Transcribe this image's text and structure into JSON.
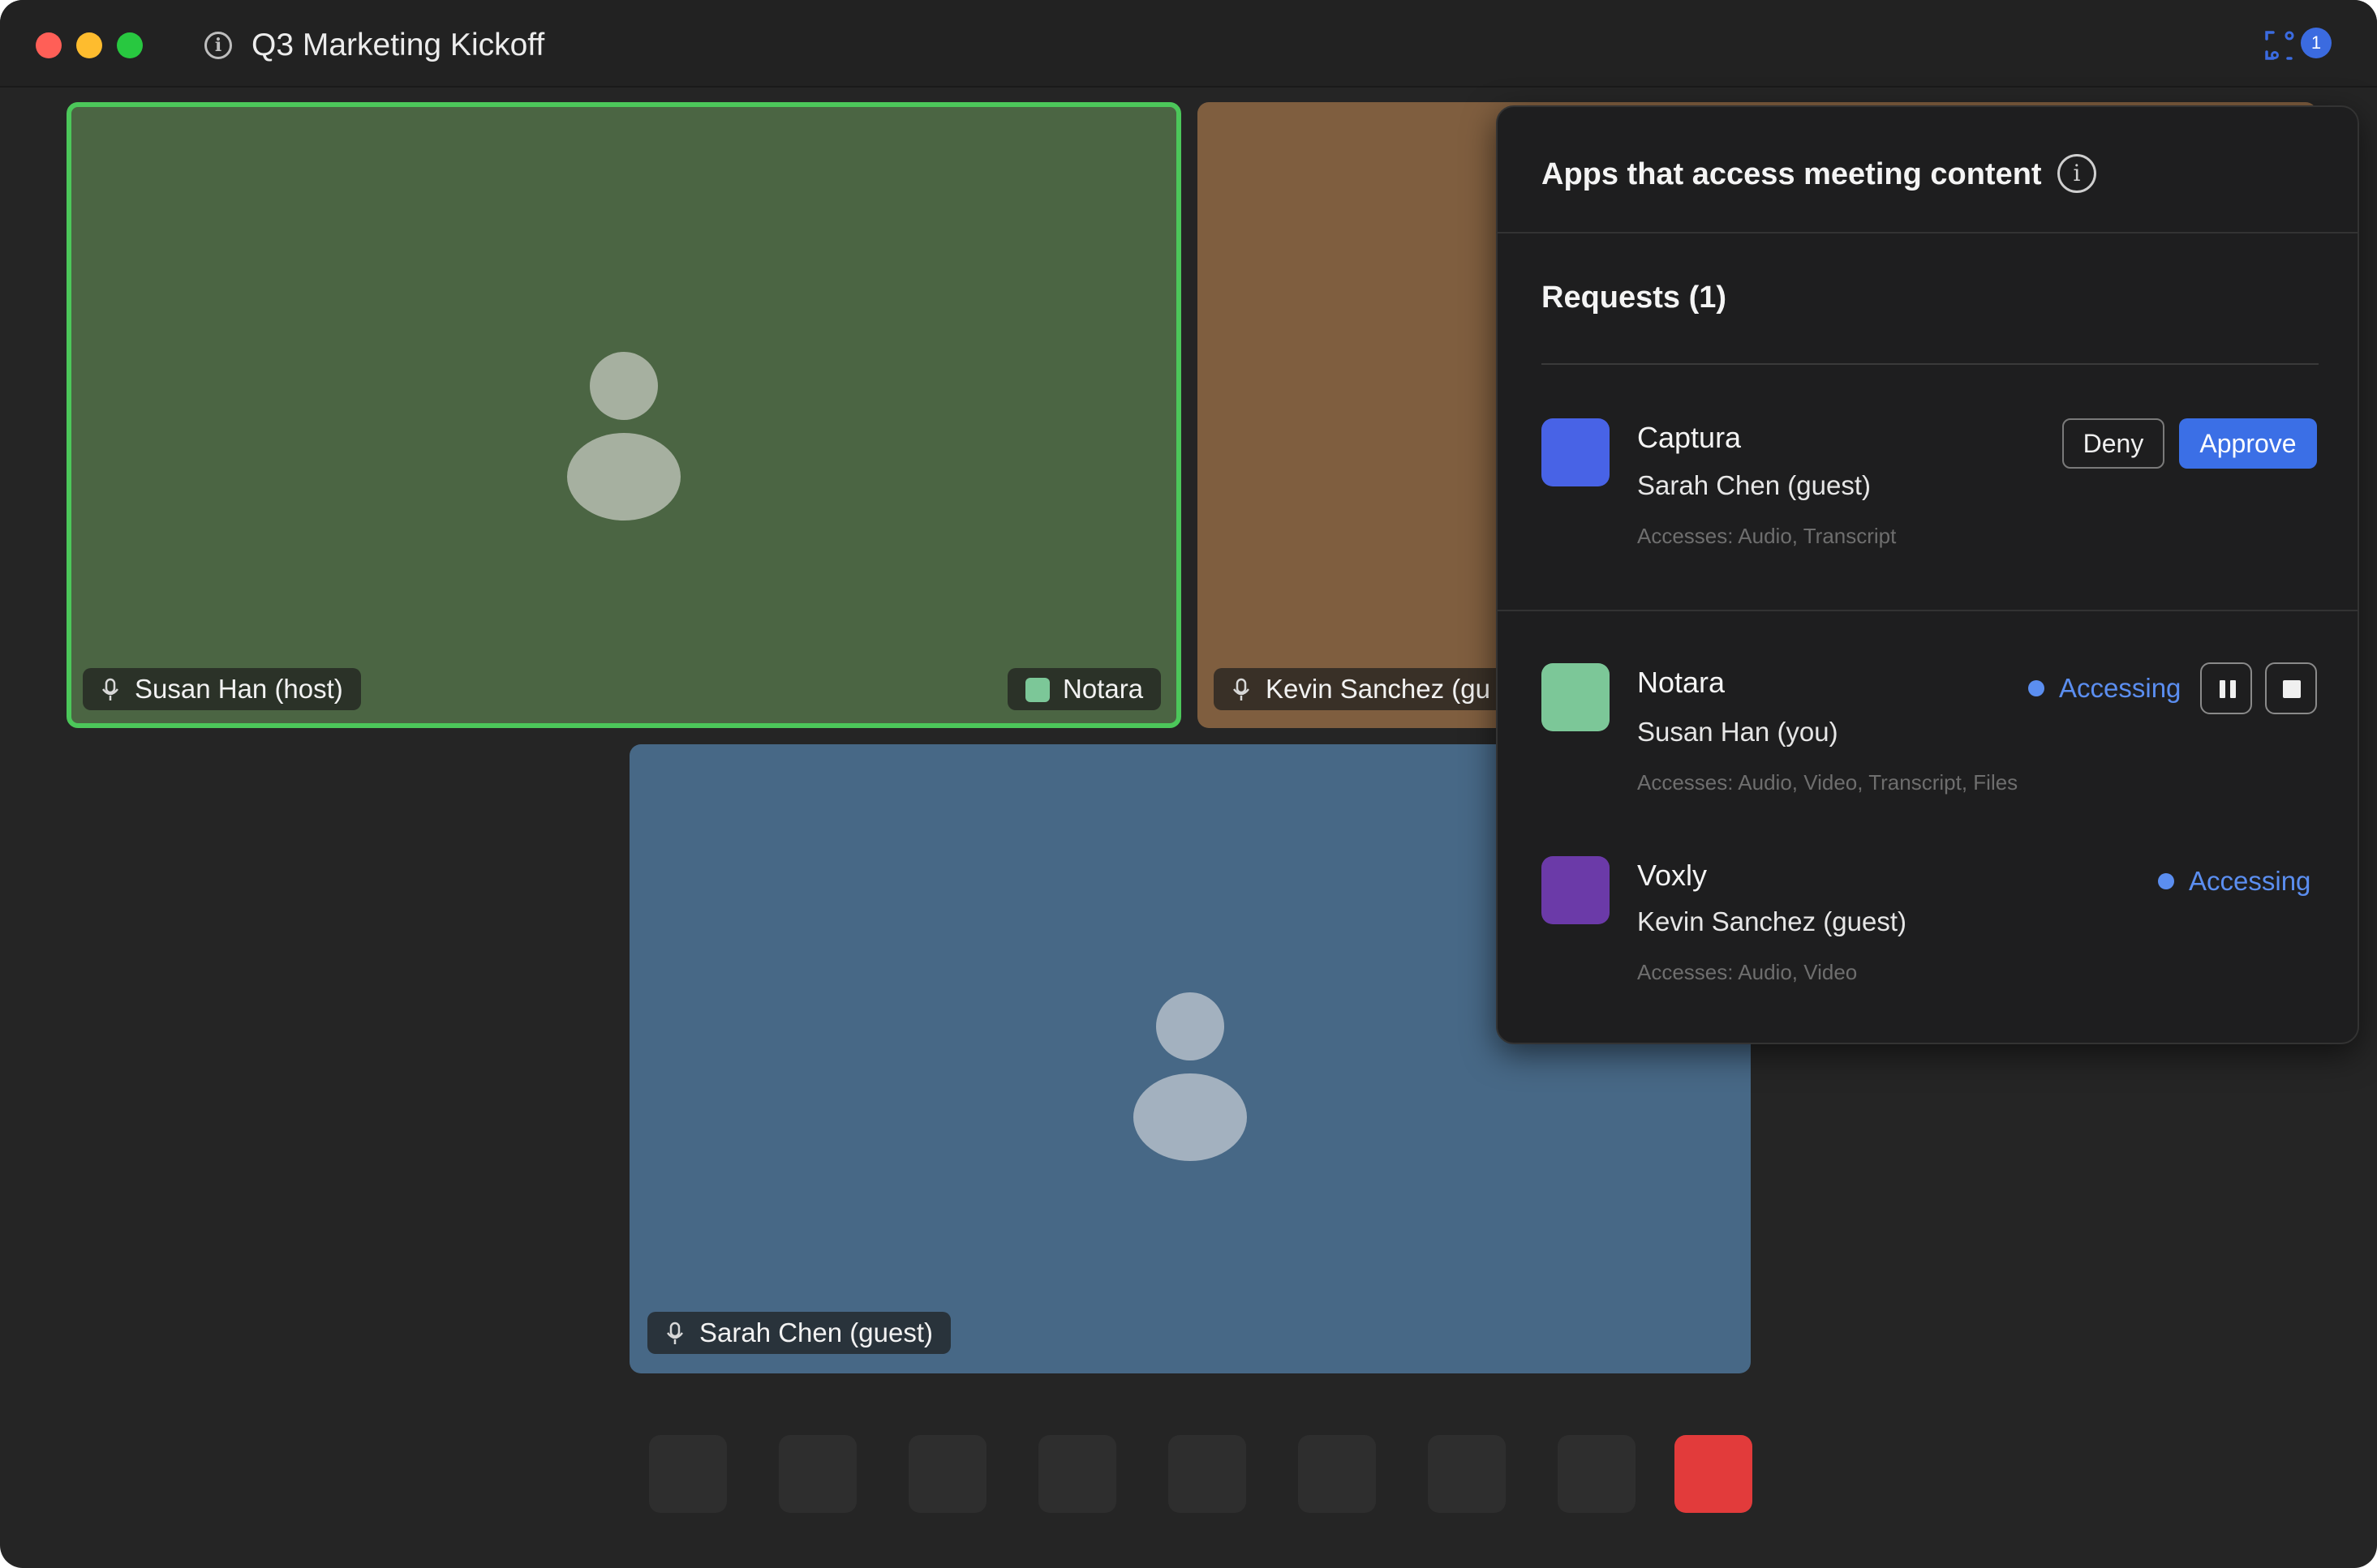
{
  "window": {
    "title": "Q3 Marketing Kickoff",
    "apps_badge_count": "1"
  },
  "tiles": {
    "susan": {
      "name": "Susan Han (host)",
      "app_label": "Notara",
      "color": "#4b6543",
      "highlight": "#4cc75a"
    },
    "kevin": {
      "name": "Kevin Sanchez (gu",
      "color": "#7f5e3f"
    },
    "sarah": {
      "name": "Sarah Chen (guest)",
      "color": "#476886"
    }
  },
  "panel": {
    "title": "Apps that access meeting content",
    "requests_label": "Requests (1)",
    "requests": [
      {
        "name": "Captura",
        "owner": "Sarah Chen (guest)",
        "accesses": "Accesses: Audio, Transcript",
        "icon_color": "#4863e6",
        "deny_label": "Deny",
        "approve_label": "Approve"
      }
    ],
    "active": [
      {
        "name": "Notara",
        "owner": "Susan Han (you)",
        "accesses": "Accesses: Audio, Video, Transcript, Files",
        "icon_color": "#7cc798",
        "status": "Accessing"
      },
      {
        "name": "Voxly",
        "owner": "Kevin Sanchez (guest)",
        "accesses": "Accesses: Audio, Video",
        "icon_color": "#6b3aa8",
        "status": "Accessing"
      }
    ]
  },
  "toolbar": {
    "button_count": 9,
    "end_color": "#e23b3b"
  }
}
